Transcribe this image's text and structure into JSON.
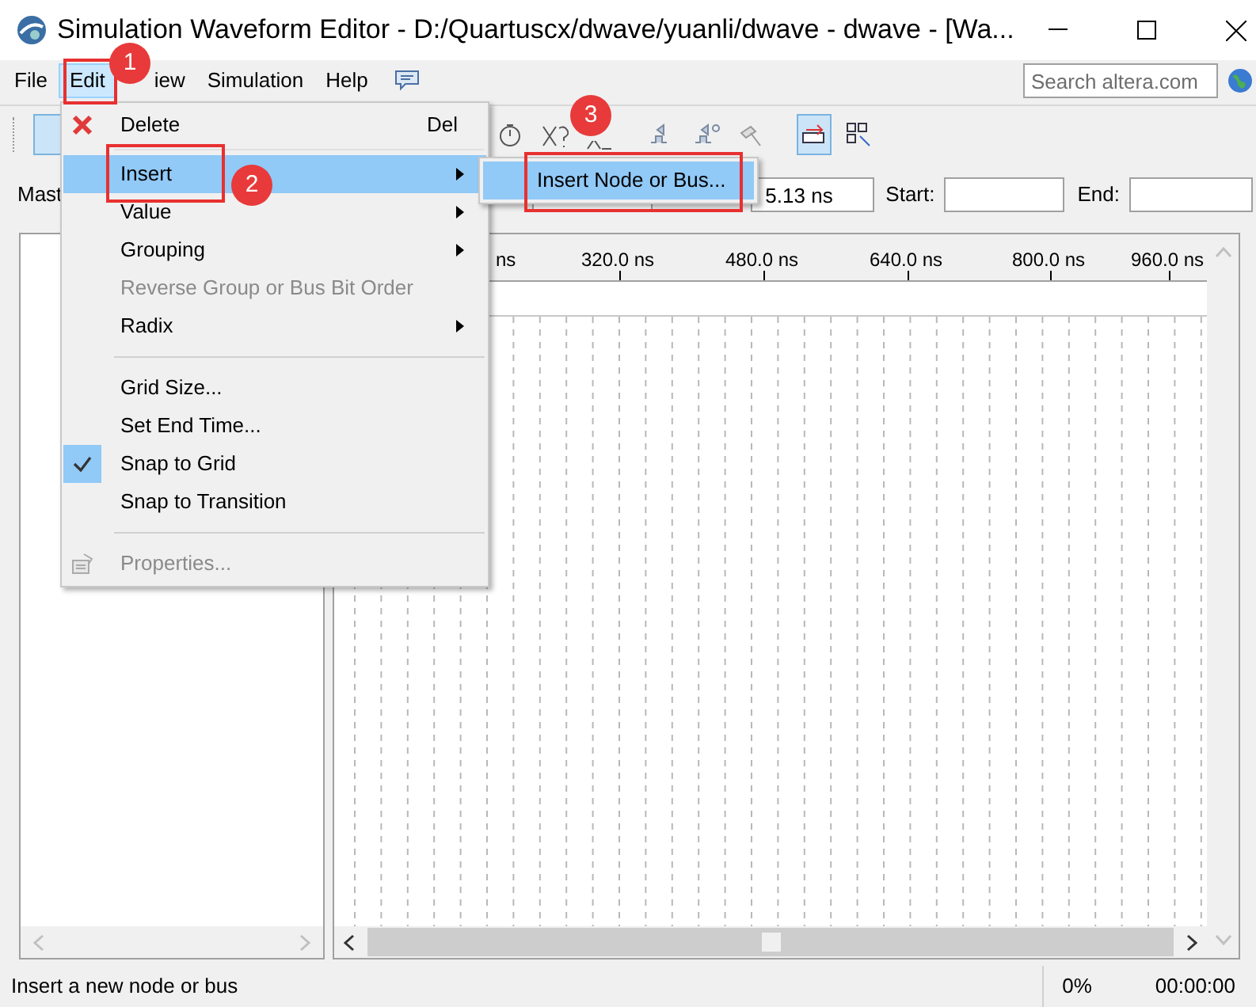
{
  "window": {
    "title": "Simulation Waveform Editor - D:/Quartuscx/dwave/yuanli/dwave - dwave - [Wa..."
  },
  "menu_bar": [
    {
      "label": "File",
      "selected": false
    },
    {
      "label": "Edit",
      "selected": true
    },
    {
      "label": "iew",
      "selected": false
    },
    {
      "label": "Simulation",
      "selected": false
    },
    {
      "label": "Help",
      "selected": false
    }
  ],
  "search": {
    "placeholder": "Search altera.com"
  },
  "master_row": {
    "label": "Mast",
    "field_value": "5.13 ns",
    "start_label": "Start:",
    "end_label": "End:"
  },
  "time_ruler": [
    "ns",
    "320.0 ns",
    "480.0 ns",
    "640.0 ns",
    "800.0 ns",
    "960.0 ns"
  ],
  "edit_menu": [
    {
      "kind": "command",
      "label": "Delete",
      "shortcut": "Del",
      "disabled": false,
      "selected": false
    },
    {
      "kind": "separator"
    },
    {
      "kind": "submenu",
      "label": "Insert",
      "disabled": false,
      "selected": true
    },
    {
      "kind": "submenu",
      "label": "Value",
      "disabled": false,
      "selected": false
    },
    {
      "kind": "submenu",
      "label": "Grouping",
      "disabled": false,
      "selected": false
    },
    {
      "kind": "command",
      "label": "Reverse Group or Bus Bit Order",
      "disabled": true,
      "selected": false
    },
    {
      "kind": "submenu",
      "label": "Radix",
      "disabled": false,
      "selected": false
    },
    {
      "kind": "separator"
    },
    {
      "kind": "command",
      "label": "Grid Size...",
      "disabled": false,
      "selected": false
    },
    {
      "kind": "command",
      "label": "Set End Time...",
      "disabled": false,
      "selected": false
    },
    {
      "kind": "check",
      "label": "Snap to Grid",
      "checked": true,
      "disabled": false,
      "selected": false
    },
    {
      "kind": "check",
      "label": "Snap to Transition",
      "checked": false,
      "disabled": false,
      "selected": false
    },
    {
      "kind": "separator"
    },
    {
      "kind": "command",
      "label": "Properties...",
      "disabled": true,
      "selected": false
    }
  ],
  "insert_submenu": [
    {
      "label": "Insert Node or Bus...",
      "selected": true
    }
  ],
  "annotations": [
    {
      "number": "1"
    },
    {
      "number": "2"
    },
    {
      "number": "3"
    }
  ],
  "status_bar": {
    "message": "Insert a new node or bus",
    "progress": "0%",
    "time": "00:00:00"
  }
}
